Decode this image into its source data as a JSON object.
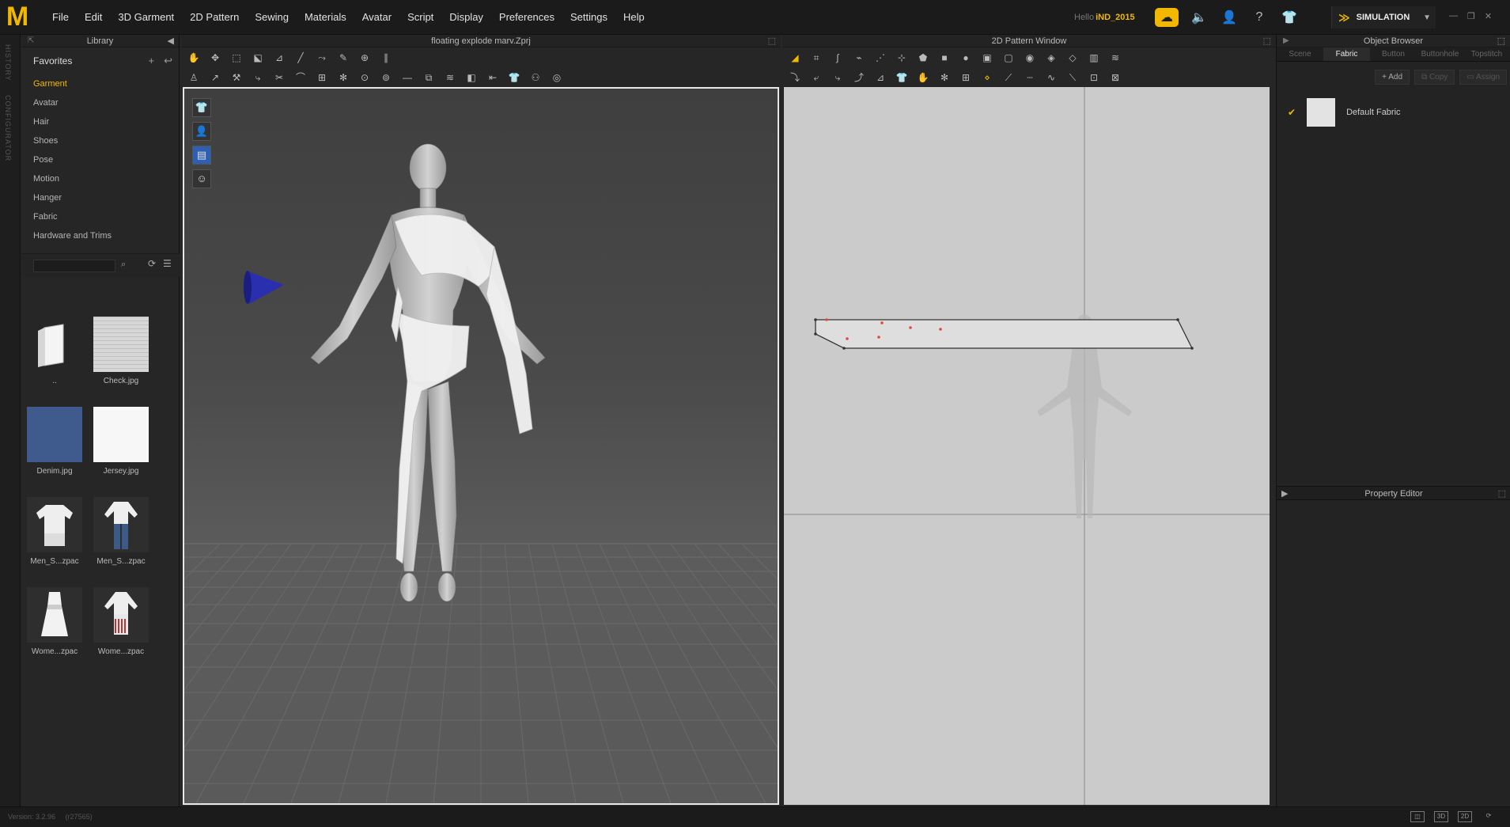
{
  "app": {
    "logo": "M"
  },
  "menu": [
    "File",
    "Edit",
    "3D Garment",
    "2D Pattern",
    "Sewing",
    "Materials",
    "Avatar",
    "Script",
    "Display",
    "Preferences",
    "Settings",
    "Help"
  ],
  "user": {
    "greeting": "Hello",
    "name": "iND_2015"
  },
  "simulation": {
    "label": "SIMULATION"
  },
  "left_strip": {
    "history": "HISTORY",
    "configurator": "CONFIGURATOR"
  },
  "library": {
    "title": "Library",
    "favorites": "Favorites",
    "items": [
      "Garment",
      "Avatar",
      "Hair",
      "Shoes",
      "Pose",
      "Motion",
      "Hanger",
      "Fabric",
      "Hardware and Trims"
    ],
    "active_index": 0,
    "thumbnails": [
      {
        "label": "..",
        "kind": "folder"
      },
      {
        "label": "Check.jpg",
        "kind": "check"
      },
      {
        "label": "Denim.jpg",
        "kind": "denim"
      },
      {
        "label": "Jersey.jpg",
        "kind": "jersey"
      },
      {
        "label": "Men_S...zpac",
        "kind": "men-shirt"
      },
      {
        "label": "Men_S...zpac",
        "kind": "men-shirt-jeans"
      },
      {
        "label": "Wome...zpac",
        "kind": "women-dress"
      },
      {
        "label": "Wome...zpac",
        "kind": "women-striped"
      }
    ]
  },
  "viewport3d": {
    "title": "floating explode marv.Zprj"
  },
  "pattern2d": {
    "title": "2D Pattern Window"
  },
  "object_browser": {
    "title": "Object Browser",
    "tabs": [
      "Scene",
      "Fabric",
      "Button",
      "Buttonhole",
      "Topstitch"
    ],
    "active_tab": 1,
    "actions": [
      "Add",
      "Copy",
      "Assign"
    ],
    "fabrics": [
      {
        "name": "Default Fabric",
        "checked": true,
        "color": "#e3e3e3"
      }
    ]
  },
  "property_editor": {
    "title": "Property Editor"
  },
  "status": {
    "version": "Version: 3.2.96",
    "build": "(r27565)",
    "view_modes": [
      "",
      "3D",
      "2D",
      ""
    ]
  },
  "colors": {
    "accent": "#f2b800",
    "avatar": "#b5b5b5",
    "fabric": "#f0f0f0",
    "cone": "#2a2fb0",
    "pattern_points": "#e04a3a"
  }
}
